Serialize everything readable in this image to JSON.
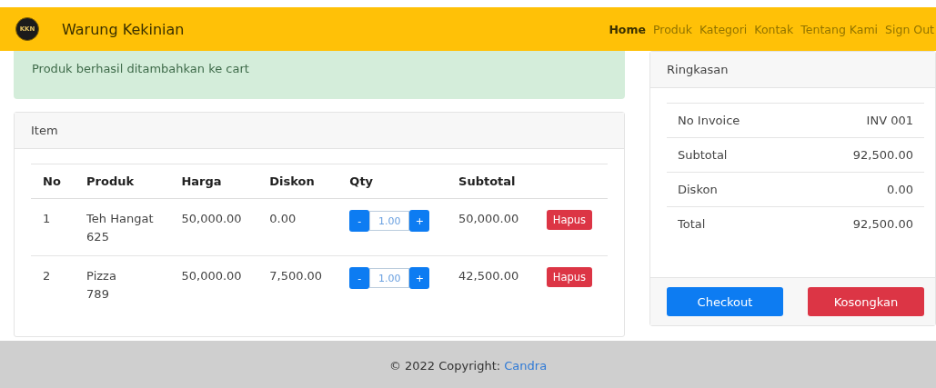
{
  "navbar": {
    "logo_text": "KKN",
    "brand": "Warung Kekinian",
    "links": [
      {
        "label": "Home",
        "selected": true
      },
      {
        "label": "Produk",
        "selected": false
      },
      {
        "label": "Kategori",
        "selected": false
      },
      {
        "label": "Kontak",
        "selected": false
      },
      {
        "label": "Tentang Kami",
        "selected": false
      },
      {
        "label": "Sign Out",
        "selected": false
      }
    ]
  },
  "alert": {
    "message": "Produk berhasil ditambahkan ke cart"
  },
  "items_card": {
    "title": "Item",
    "table": {
      "columns": [
        "No",
        "Produk",
        "Harga",
        "Diskon",
        "Qty",
        "Subtotal"
      ],
      "rows": [
        {
          "no": "1",
          "product": "Teh Hangat",
          "code": "625",
          "price": "50,000.00",
          "discount": "0.00",
          "qty": "1.00",
          "minus": "-",
          "plus": "+",
          "subtotal": "50,000.00",
          "remove": "Hapus"
        },
        {
          "no": "2",
          "product": "Pizza",
          "code": "789",
          "price": "50,000.00",
          "discount": "7,500.00",
          "qty": "1.00",
          "minus": "-",
          "plus": "+",
          "subtotal": "42,500.00",
          "remove": "Hapus"
        }
      ]
    }
  },
  "summary": {
    "title": "Ringkasan",
    "rows": [
      {
        "label": "No Invoice",
        "value": "INV 001"
      },
      {
        "label": "Subtotal",
        "value": "92,500.00"
      },
      {
        "label": "Diskon",
        "value": "0.00"
      },
      {
        "label": "Total",
        "value": "92,500.00"
      }
    ],
    "buttons": [
      {
        "label": "Checkout",
        "kind": "primary"
      },
      {
        "label": "Kosongkan",
        "kind": "danger"
      }
    ]
  },
  "footer": {
    "text": "© 2022 Copyright: ",
    "link": "Candra"
  }
}
